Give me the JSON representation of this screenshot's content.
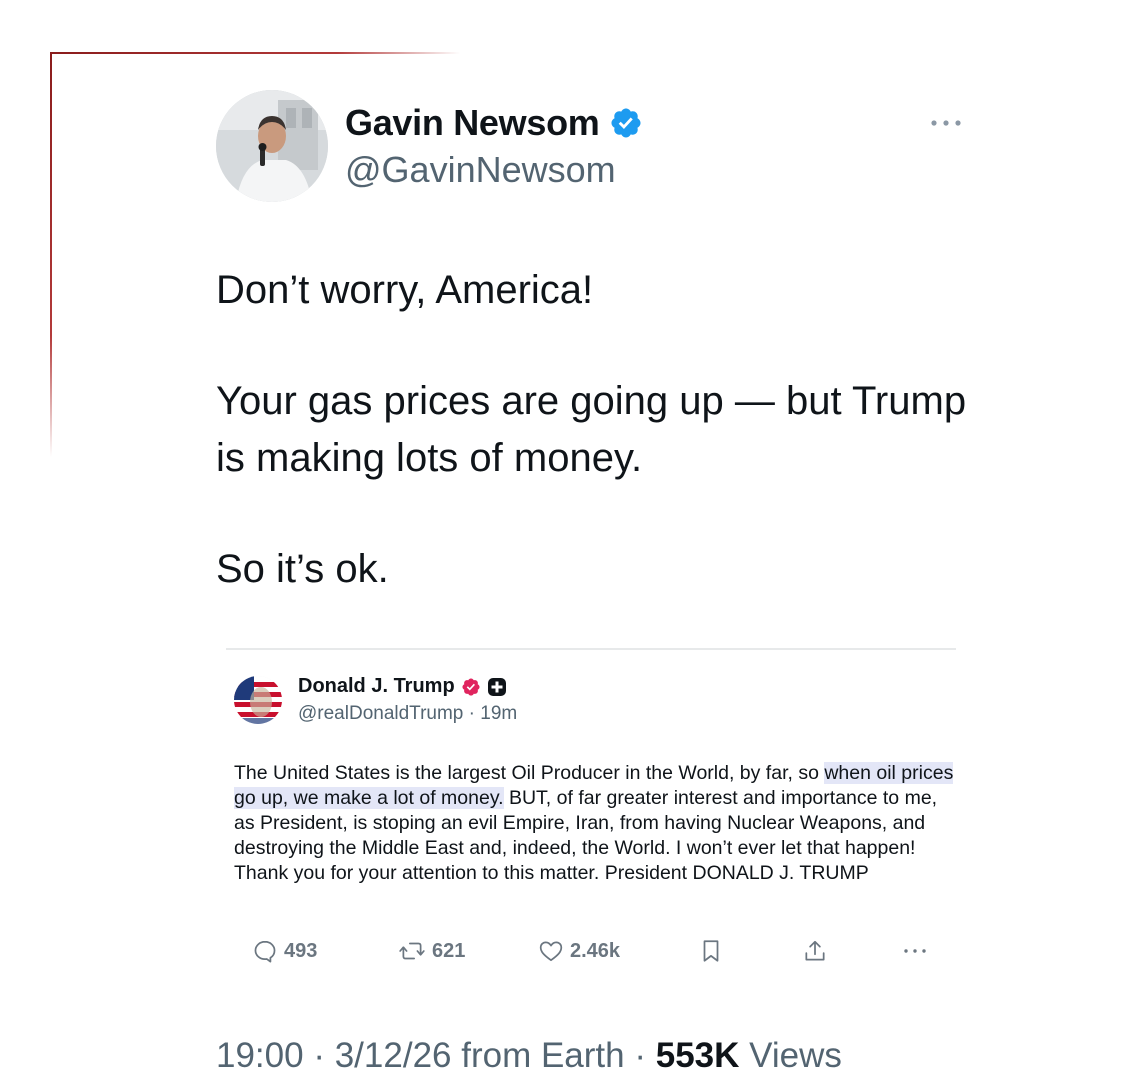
{
  "author": {
    "display_name": "Gavin Newsom",
    "handle": "@GavinNewsom",
    "verified_icon": "verified-badge-icon",
    "verified_color": "#1d9bf0"
  },
  "tweet": {
    "paragraphs": [
      "Don’t worry, America!",
      "Your gas prices are going up — but Trump is making lots of money.",
      "So it’s ok."
    ]
  },
  "embedded": {
    "display_name": "Donald J. Trump",
    "handle": "@realDonaldTrump",
    "separator": "·",
    "time": "19m",
    "badge_color": "#e0245e",
    "text_before": "The United States is the largest Oil Producer in the World, by far, so ",
    "text_highlight": "when oil prices go up, we make a lot of money.",
    "text_after": " BUT, of far greater interest and importance to me, as President, is stoping an evil Empire, Iran, from having Nuclear Weapons, and destroying the Middle East and, indeed, the World. I won’t ever let that happen! Thank you for your attention to this matter. President DONALD J. TRUMP",
    "actions": {
      "replies": "493",
      "reposts": "621",
      "likes": "2.46k"
    }
  },
  "footer": {
    "time": "19:00",
    "sep1": "·",
    "date": "3/12/26",
    "source": "from Earth",
    "sep2": "·",
    "views_count": "553K",
    "views_label": "Views"
  }
}
